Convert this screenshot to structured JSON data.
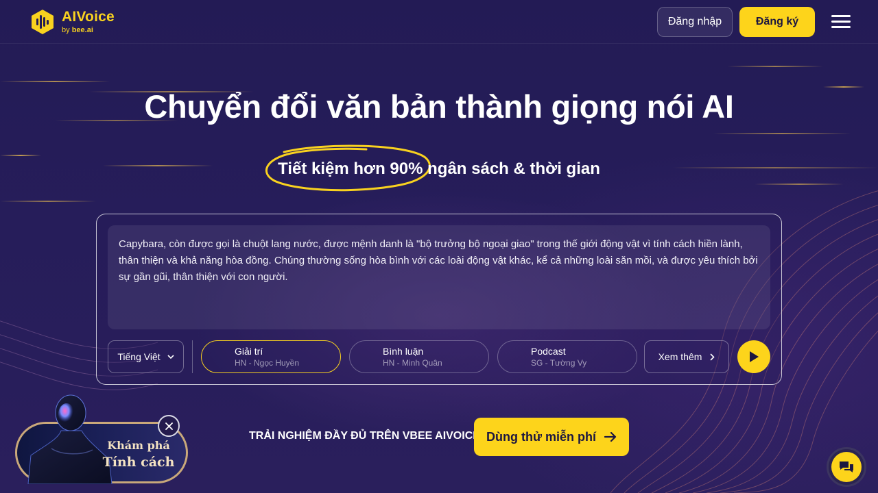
{
  "brand": {
    "name": "AIVoice",
    "by": "by",
    "partner": "bee.ai"
  },
  "header": {
    "login_label": "Đăng nhập",
    "signup_label": "Đăng ký"
  },
  "hero": {
    "title": "Chuyển đổi văn bản thành giọng nói AI",
    "sub_highlight": "Tiết kiệm hơn 90%",
    "sub_rest": " ngân sách & thời gian"
  },
  "demo": {
    "text": "Capybara, còn được gọi là chuột lang nước, được mệnh danh là \"bộ trưởng bộ ngoại giao\" trong thế giới động vật vì tính cách hiền lành, thân thiện và khả năng hòa đồng. Chúng thường sống hòa bình với các loài động vật khác, kể cả những loài săn mồi, và được yêu thích bởi sự gần gũi, thân thiện với con người.",
    "language": "Tiếng Việt",
    "voices": [
      {
        "name": "Giải trí",
        "desc": "HN - Ngọc Huyền"
      },
      {
        "name": "Bình luận",
        "desc": "HN - Minh Quân"
      },
      {
        "name": "Podcast",
        "desc": "SG - Tường Vy"
      }
    ],
    "more_label": "Xem thêm"
  },
  "cta": {
    "text": "TRẢI NGHIỆM ĐẦY ĐỦ TRÊN VBEE AIVOICE",
    "button": "Dùng thử miễn phí"
  },
  "promo": {
    "line1": "Khám phá",
    "line2": "Tính cách"
  },
  "colors": {
    "accent": "#fdd41b",
    "background": "#1f1950"
  }
}
